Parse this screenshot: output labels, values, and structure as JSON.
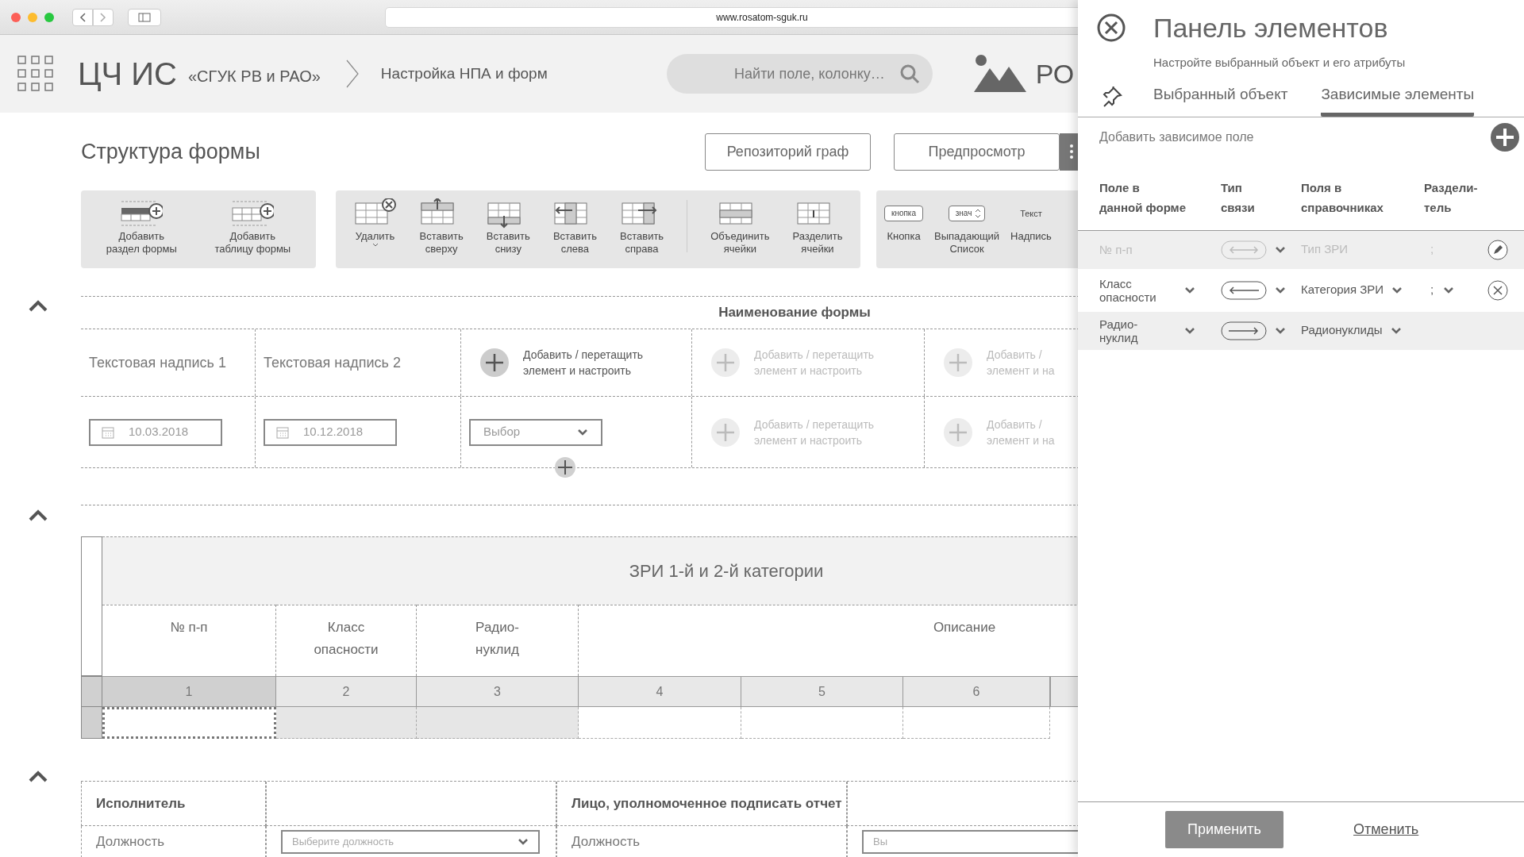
{
  "browser": {
    "url": "www.rosatom-sguk.ru"
  },
  "header": {
    "app_title": "ЦЧ ИС",
    "app_subtitle": "«СГУК РВ и РАО»",
    "breadcrumb": "Настройка НПА и форм",
    "search": {
      "placeholder": "Найти поле, колонку…"
    },
    "brand": "РО"
  },
  "page": {
    "title": "Структура формы",
    "buttons": [
      "Репозиторий граф",
      "Предпросмотр"
    ]
  },
  "toolbar": [
    {
      "items": [
        {
          "kind": "add-section",
          "label": "Добавить\nраздел формы"
        },
        {
          "kind": "add-table",
          "label": "Добавить\nтаблицу формы"
        }
      ]
    },
    {
      "items": [
        {
          "kind": "delete",
          "label": "Удалить",
          "has_menu": true
        },
        {
          "kind": "insert-above",
          "label": "Вставить\nсверху"
        },
        {
          "kind": "insert-below",
          "label": "Вставить\nснизу"
        },
        {
          "kind": "insert-left",
          "label": "Вставить\nслева"
        },
        {
          "kind": "insert-right",
          "label": "Вставить\nсправа"
        },
        {
          "kind": "merge",
          "label": "Объединить\nячейки",
          "divider_before": true
        },
        {
          "kind": "split",
          "label": "Разделить\nячейки"
        }
      ]
    },
    {
      "items": [
        {
          "kind": "button-sample",
          "sample": "кнопка",
          "label": "Кнопка"
        },
        {
          "kind": "dropdown-sample",
          "sample": "знач",
          "label": "Выпадающий\nСписок"
        },
        {
          "kind": "text-sample",
          "sample": "Текст",
          "label": "Надпись"
        }
      ]
    }
  ],
  "form_section": {
    "expanded": true,
    "title": "Наименование формы",
    "rows": [
      [
        {
          "kind": "text",
          "text": "Текстовая надпись 1"
        },
        {
          "kind": "text",
          "text": "Текстовая надпись 2"
        },
        {
          "kind": "add",
          "text": "Добавить / перетащить\nэлемент и настроить",
          "active": true
        },
        {
          "kind": "add",
          "text": "Добавить / перетащить\nэлемент и настроить",
          "active": false
        },
        {
          "kind": "add",
          "text": "Добавить /\nэлемент и на",
          "active": false
        }
      ],
      [
        {
          "kind": "date",
          "value": "10.03.2018"
        },
        {
          "kind": "date",
          "value": "10.12.2018"
        },
        {
          "kind": "select",
          "value": "Выбор"
        },
        {
          "kind": "add",
          "text": "Добавить / перетащить\nэлемент и настроить",
          "active": false
        },
        {
          "kind": "add",
          "text": "Добавить /\nэлемент и на",
          "active": false
        }
      ]
    ]
  },
  "table_section": {
    "expanded": true,
    "title": "ЗРИ 1-й и 2-й категории",
    "headers": [
      "№ п-п",
      "Класс\nопасности",
      "Радио-\nнуклид",
      "Описание"
    ],
    "numbers": [
      {
        "label": "1",
        "selected": true
      },
      {
        "label": "2",
        "selected": false
      },
      {
        "label": "3",
        "selected": false
      },
      {
        "label": "4",
        "selected": false
      },
      {
        "label": "5",
        "selected": false
      },
      {
        "label": "6",
        "selected": false
      }
    ],
    "data_row": [
      {
        "selected": true,
        "shaded": false
      },
      {
        "selected": false,
        "shaded": true
      },
      {
        "selected": false,
        "shaded": true
      },
      {
        "selected": false,
        "shaded": false
      },
      {
        "selected": false,
        "shaded": false
      },
      {
        "selected": false,
        "shaded": false
      }
    ]
  },
  "signers_section": {
    "expanded": true,
    "headers": [
      "Исполнитель",
      "Лицо, уполномоченное подписать отчет"
    ],
    "row": [
      {
        "kind": "label",
        "text": "Должность"
      },
      {
        "kind": "select",
        "placeholder": "Выберите должность"
      },
      {
        "kind": "label",
        "text": "Должность"
      },
      {
        "kind": "select",
        "placeholder": "Вы"
      }
    ]
  },
  "panel": {
    "title": "Панель элементов",
    "subtitle": "Настройте выбранный объект и его атрибуты",
    "tabs": [
      {
        "label": "Выбранный объект",
        "selected": false
      },
      {
        "label": "Зависимые элементы",
        "selected": true
      }
    ],
    "add_label": "Добавить зависимое поле",
    "columns": [
      "Поле в\nданной форме",
      "Тип\nсвязи",
      "Поля в\nсправочниках",
      "Раздели-\nтель"
    ],
    "rows": [
      {
        "field": "№ п-п",
        "link": {
          "kind": "both"
        },
        "reference": "Тип ЗРИ",
        "separator": ";",
        "disabled": true,
        "action": {
          "kind": "edit"
        }
      },
      {
        "field": "Класс\nопасности",
        "link": {
          "kind": "left"
        },
        "reference": "Категория ЗРИ",
        "separator": ";",
        "disabled": false,
        "action": {
          "kind": "delete"
        }
      },
      {
        "field": "Радио-\nнуклид",
        "link": {
          "kind": "right"
        },
        "reference": "Радионуклиды",
        "disabled": false
      }
    ],
    "apply": "Применить",
    "cancel": "Отменить"
  }
}
